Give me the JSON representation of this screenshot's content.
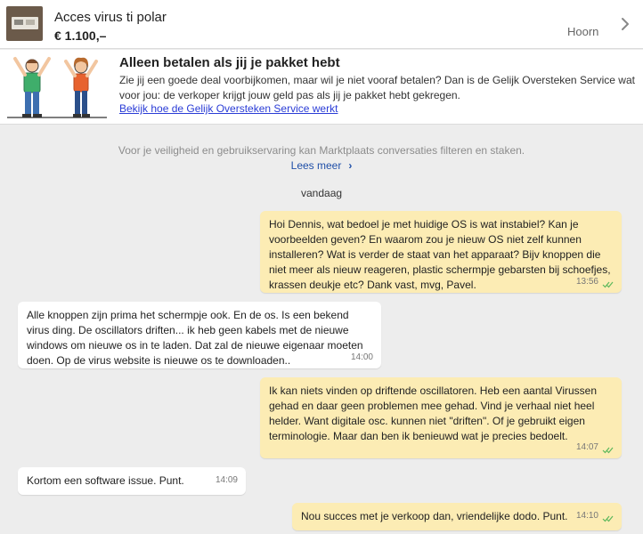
{
  "listing": {
    "title": "Acces virus ti polar",
    "price": "€ 1.100,–",
    "status": "Hoorn"
  },
  "banner": {
    "title": "Alleen betalen als jij je pakket hebt",
    "text": "Zie jij een goede deal voorbijkomen, maar wil je niet vooraf betalen? Dan is de Gelijk Oversteken Service wat voor jou: de verkoper krijgt jouw geld pas als jij je pakket hebt gekregen.",
    "link": "Bekijk hoe de Gelijk Oversteken Service werkt"
  },
  "notice": {
    "text": "Voor je veiligheid en gebruikservaring kan Marktplaats conversaties filteren en staken.",
    "link": "Lees meer",
    "link_arrow": "›"
  },
  "day_label": "vandaag",
  "messages": [
    {
      "direction": "out",
      "text": "Hoi Dennis, wat bedoel je met huidige OS is wat instabiel? Kan je voorbeelden geven? En waarom zou je nieuw OS niet zelf kunnen installeren? Wat is verder de staat van het apparaat? Bijv knoppen die niet meer als nieuw reageren, plastic schermpje gebarsten bij schoefjes, krassen deukje etc? Dank vast, mvg, Pavel.",
      "time": "13:56",
      "read": true
    },
    {
      "direction": "in",
      "text": "Alle knoppen zijn prima het schermpje ook.   En de os.     Is een bekend virus ding.      De oscillators driften...  ik heb geen kabels met de nieuwe windows om nieuwe os in te laden.     Dat zal de nieuwe eigenaar moeten doen. Op de virus website is nieuwe os te downloaden..",
      "time": "14:00"
    },
    {
      "direction": "out",
      "text": "Ik kan niets vinden op driftende oscillatoren. Heb een aantal Virussen gehad en daar geen problemen mee gehad. Vind je verhaal niet heel helder. Want digitale osc. kunnen niet \"driften\". Of je gebruikt eigen terminologie. Maar dan ben ik benieuwd wat je precies bedoelt.",
      "time": "14:07",
      "read": true
    },
    {
      "direction": "in",
      "text": "Kortom een software issue.  Punt.",
      "time": "14:09"
    },
    {
      "direction": "out",
      "text": "Nou succes met je verkoop dan, vriendelijke dodo. Punt.",
      "time": "14:10",
      "read": true
    }
  ],
  "colors": {
    "outgoing_bubble": "#fcecb4",
    "incoming_bubble": "#ffffff",
    "read_ticks": "#5cb85c",
    "link": "#2a3cd6",
    "background": "#ededed"
  }
}
